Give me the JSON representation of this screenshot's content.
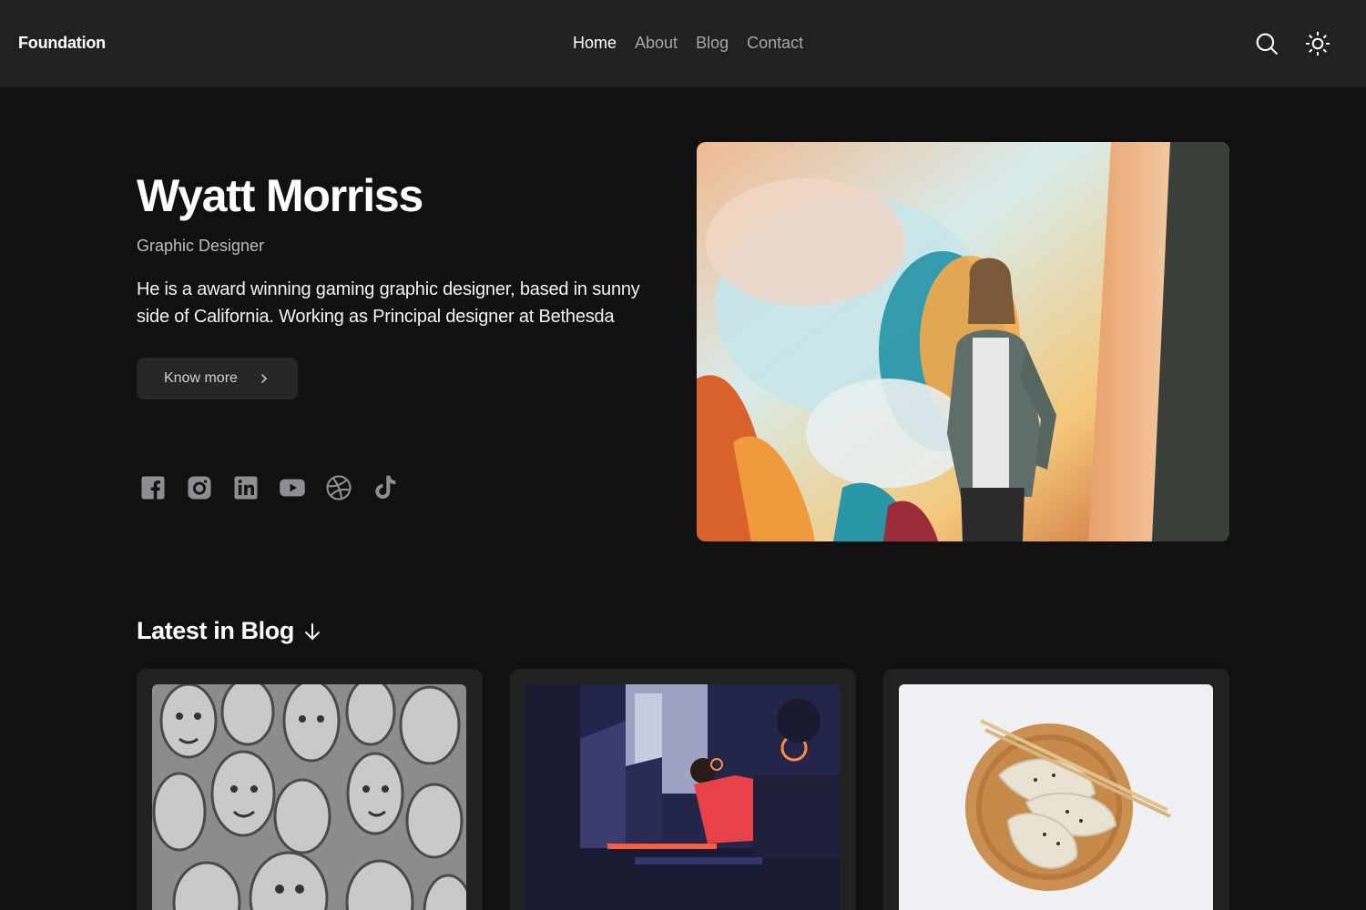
{
  "header": {
    "brand": "Foundation",
    "nav": [
      "Home",
      "About",
      "Blog",
      "Contact"
    ],
    "active": "Home",
    "icons": [
      "search-icon",
      "sun-icon"
    ]
  },
  "hero": {
    "name": "Wyatt Morriss",
    "role": "Graphic Designer",
    "bio": "He is a award winning gaming graphic designer, based in sunny side of California. Working as Principal designer at Bethesda",
    "cta_label": "Know more",
    "socials": [
      "facebook-icon",
      "instagram-icon",
      "linkedin-icon",
      "youtube-icon",
      "dribbble-icon",
      "tiktok-icon"
    ]
  },
  "blog": {
    "title": "Latest in Blog",
    "cards": [
      {
        "image": "carved-stone-faces-photo"
      },
      {
        "image": "gamers-at-computers-photo"
      },
      {
        "image": "dumplings-on-wooden-plate-photo"
      }
    ]
  },
  "colors": {
    "background": "#111112",
    "header": "#212122",
    "card": "#212122",
    "button": "#262628"
  }
}
